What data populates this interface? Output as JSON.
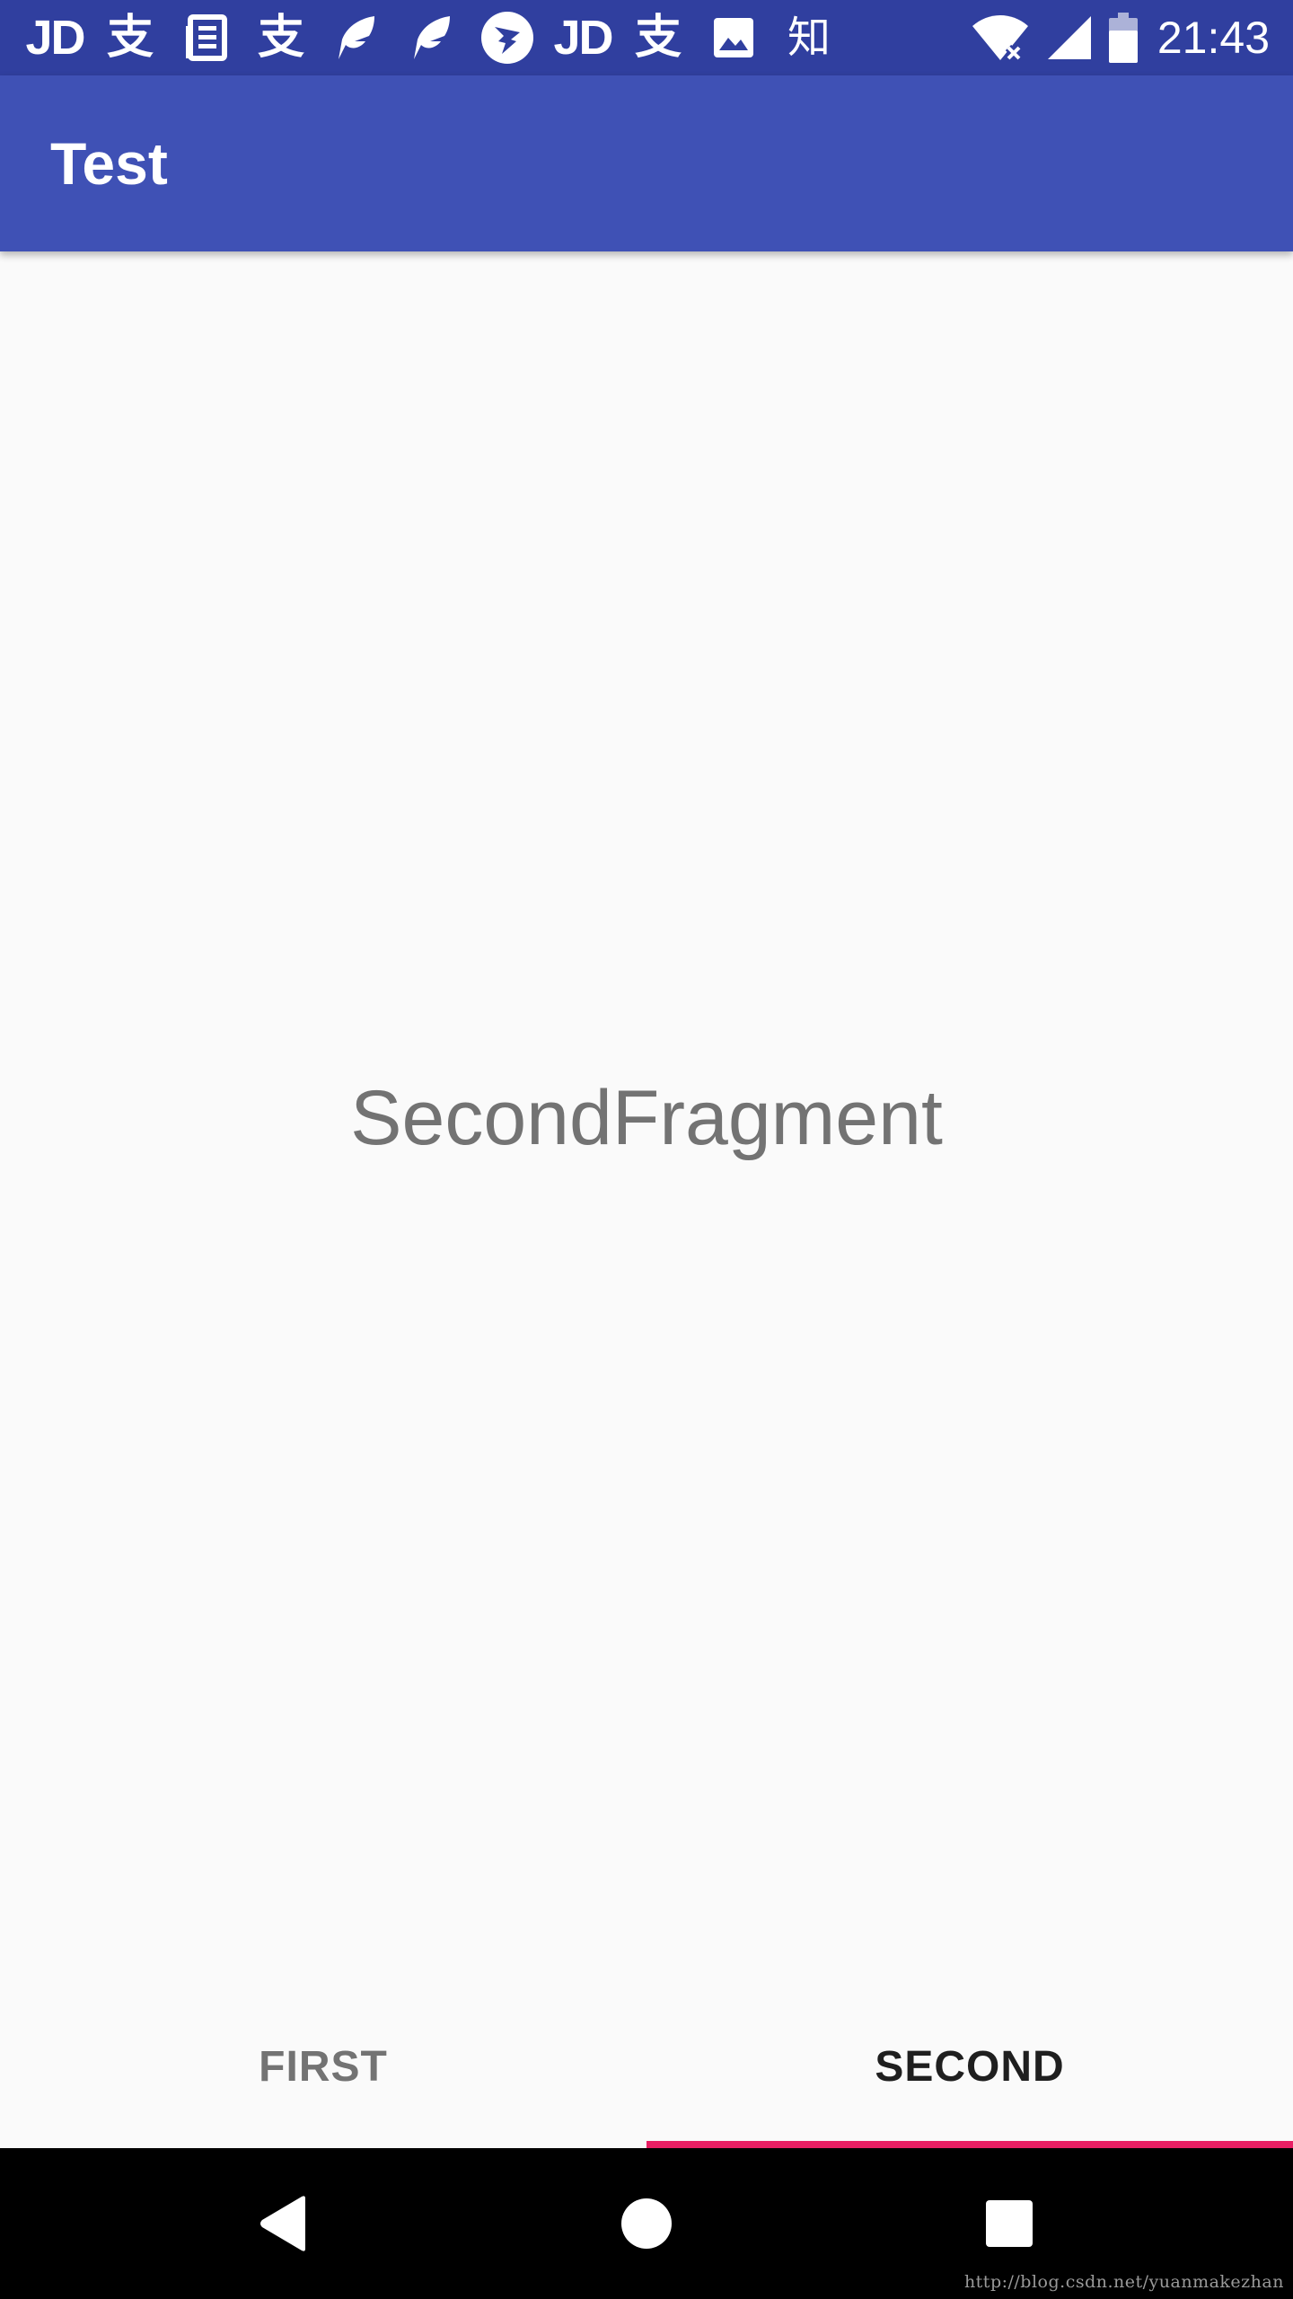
{
  "status_bar": {
    "notification_icons": [
      {
        "name": "jd-icon",
        "text": "JD"
      },
      {
        "name": "alipay-icon",
        "text": "支"
      },
      {
        "name": "news-icon"
      },
      {
        "name": "alipay-icon",
        "text": "支"
      },
      {
        "name": "feather-icon"
      },
      {
        "name": "feather-icon"
      },
      {
        "name": "dingtalk-icon"
      },
      {
        "name": "jd-icon",
        "text": "JD"
      },
      {
        "name": "alipay-icon",
        "text": "支"
      },
      {
        "name": "image-icon"
      },
      {
        "name": "zhihu-icon",
        "text": "知"
      }
    ],
    "wifi_icon": "wifi-no-internet-icon",
    "signal_icon": "cell-signal-icon",
    "battery_icon": "battery-icon",
    "time": "21:43"
  },
  "app_bar": {
    "title": "Test"
  },
  "content": {
    "fragment_text": "SecondFragment"
  },
  "tabs": [
    {
      "label": "FIRST",
      "active": false
    },
    {
      "label": "SECOND",
      "active": true
    }
  ],
  "nav_bar": {
    "back_icon": "back-triangle-icon",
    "home_icon": "home-circle-icon",
    "recents_icon": "recents-square-icon"
  },
  "watermark": "http://blog.csdn.net/yuanmakezhan",
  "colors": {
    "status_bar": "#303F9F",
    "app_bar": "#3F51B5",
    "tab_indicator": "#E91E63",
    "background": "#FAFAFA",
    "nav_bar": "#000000"
  }
}
